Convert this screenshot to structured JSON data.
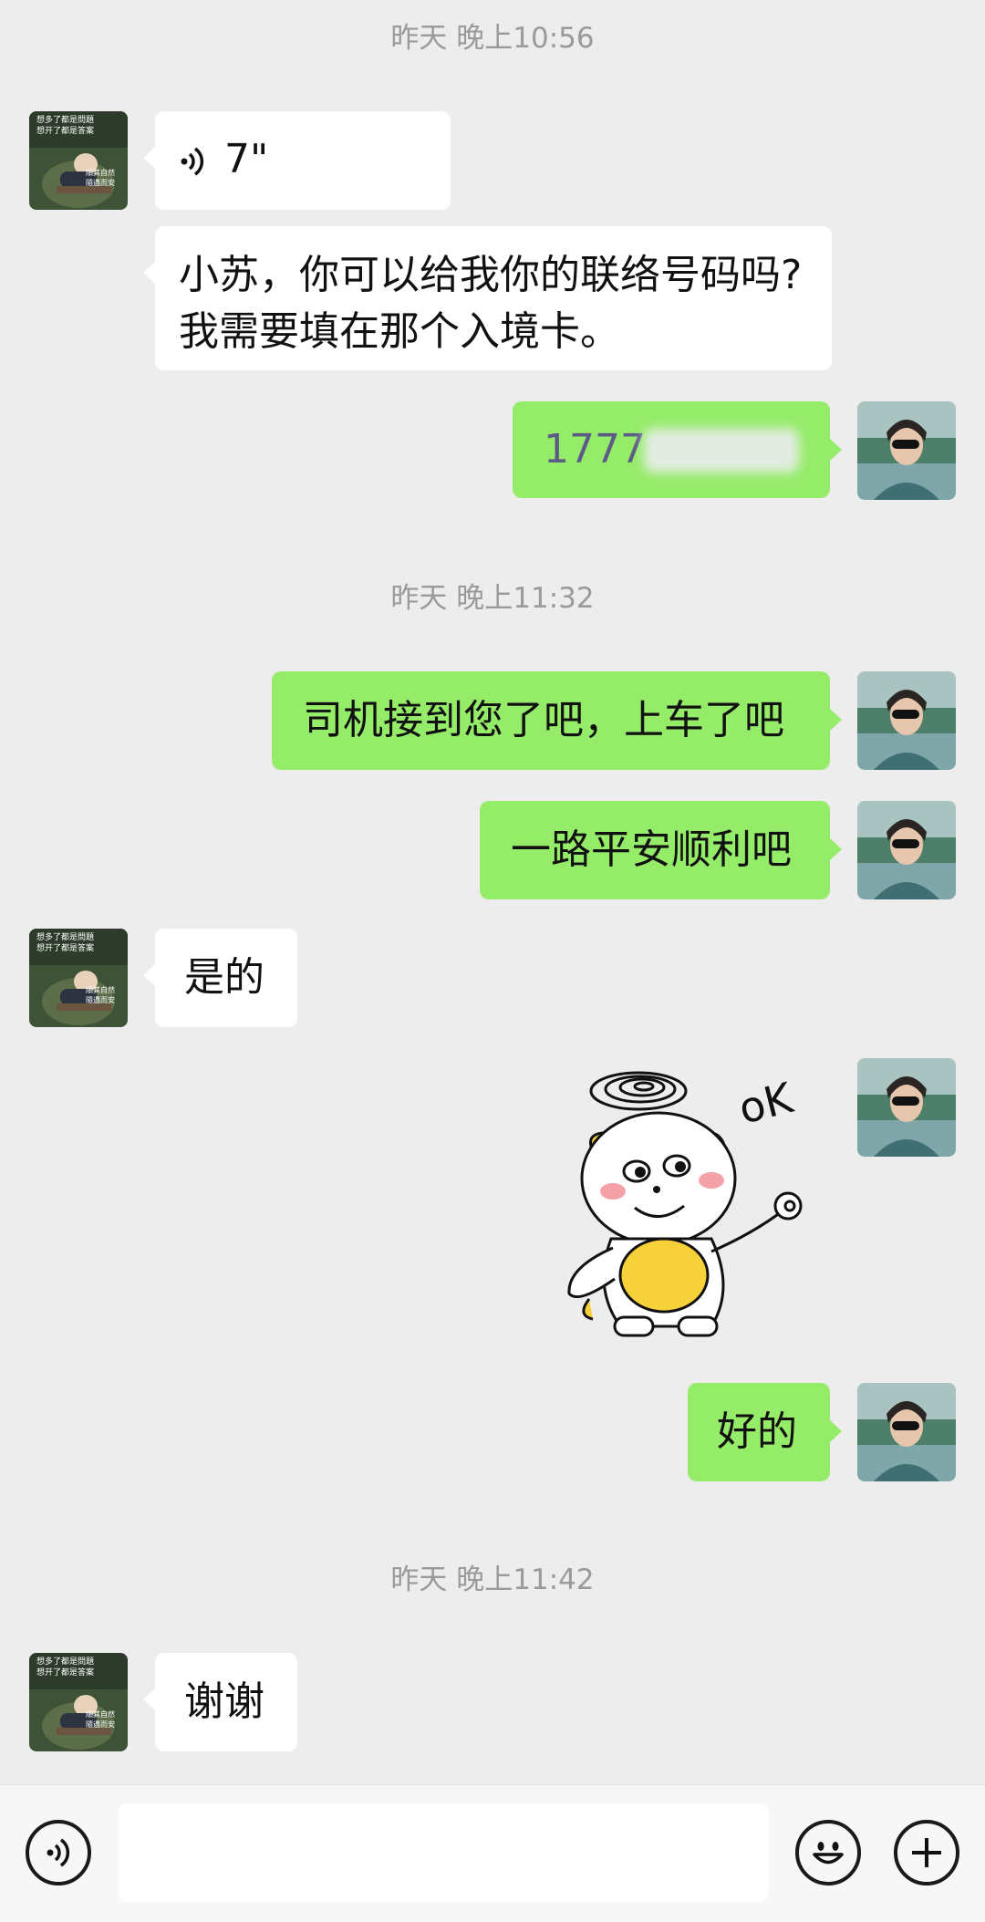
{
  "timestamps": [
    "昨天 晚上10:56",
    "昨天 晚上11:32",
    "昨天 晚上11:42"
  ],
  "messages": {
    "voice_duration": "7\"",
    "m1_line1": "小苏，你可以给我你的联络号码吗?",
    "m1_line2": "我需要填在那个入境卡。",
    "phone_visible": "1777",
    "m2": "司机接到您了吧，上车了吧",
    "m3": "一路平安顺利吧",
    "m4": "是的",
    "sticker_text": "oK",
    "m5": "好的",
    "m6": "谢谢"
  },
  "contact_avatar_text": {
    "top_line1": "想多了都是問題",
    "top_line2": "想开了都是答案",
    "bottom_line1": "順其自然",
    "bottom_line2": "隨遇而安"
  },
  "icons": {
    "voice": "voice-icon",
    "emoji": "emoji-icon",
    "plus": "plus-icon",
    "voice_wave": "voice-wave-icon"
  },
  "colors": {
    "background": "#ededed",
    "outgoing_bubble": "#95ec69",
    "incoming_bubble": "#ffffff"
  }
}
